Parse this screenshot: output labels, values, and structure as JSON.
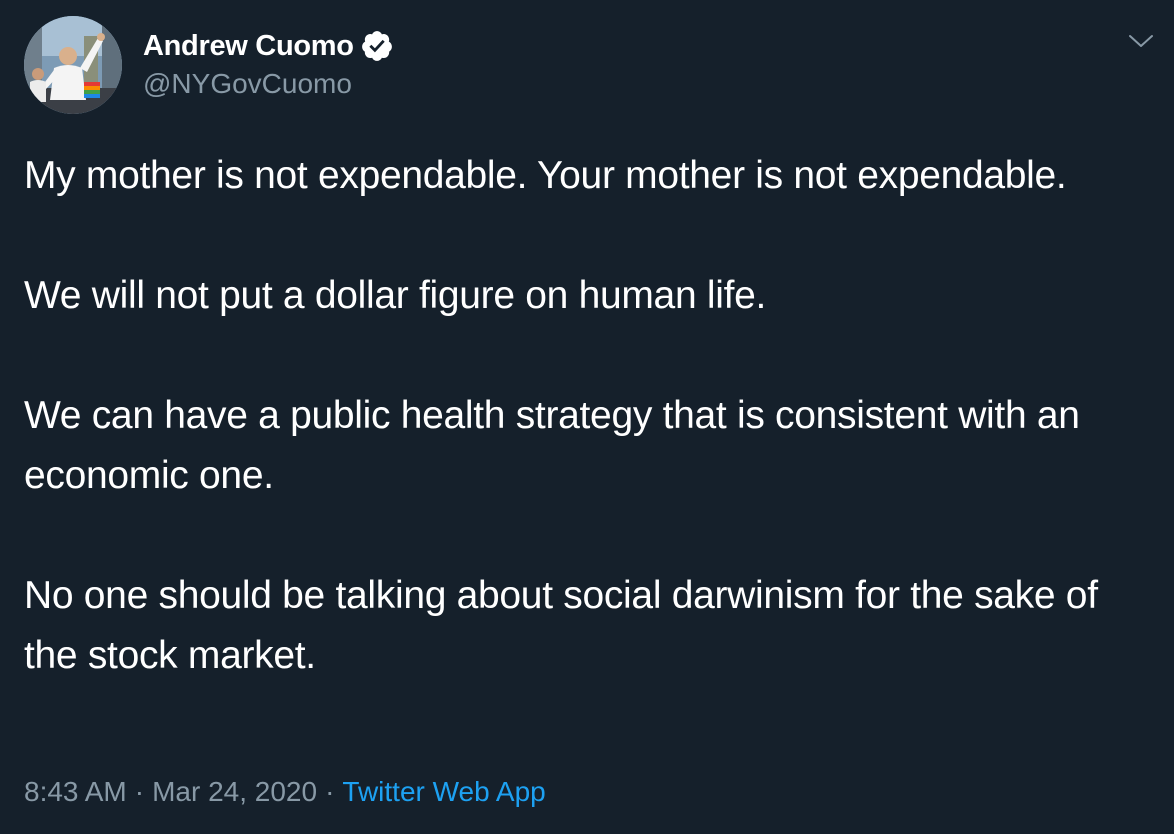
{
  "tweet": {
    "author_name": "Andrew Cuomo",
    "author_handle": "@NYGovCuomo",
    "paragraphs": [
      "My mother is not expendable. Your mother is not expendable.",
      "We will not put a dollar figure on human life.",
      "We can have a public health strategy that is consistent with an economic one.",
      "No one should be talking about social darwinism for the sake of the stock market."
    ],
    "time": "8:43 AM",
    "separator": "·",
    "date": "Mar 24, 2020",
    "source": "Twitter Web App"
  },
  "icons": {
    "verified": "verified-badge-icon",
    "menu": "chevron-down-icon"
  },
  "colors": {
    "background": "#15202b",
    "text": "#ffffff",
    "secondary": "#8899a6",
    "link": "#1da1f2"
  }
}
